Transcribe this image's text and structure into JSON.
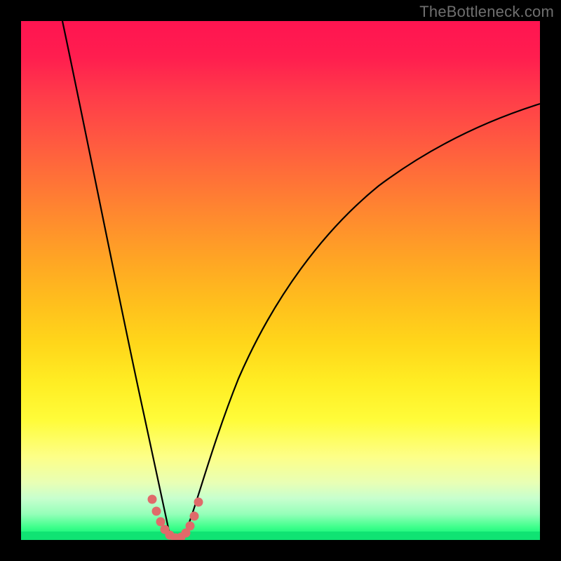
{
  "watermark": "TheBottleneck.com",
  "chart_data": {
    "type": "line",
    "title": "",
    "xlabel": "",
    "ylabel": "",
    "xlim": [
      0,
      100
    ],
    "ylim": [
      0,
      100
    ],
    "background_gradient": {
      "top": "#ff1450",
      "bottom": "#10e373",
      "meaning": "red=high bottleneck, green=low bottleneck"
    },
    "series": [
      {
        "name": "left-arm",
        "x": [
          8,
          10,
          12,
          14,
          16,
          18,
          20,
          22,
          24,
          25,
          26,
          27,
          28
        ],
        "values": [
          100,
          85,
          71,
          58,
          47,
          36,
          27,
          18,
          10,
          6,
          3,
          1.2,
          0.3
        ]
      },
      {
        "name": "right-arm",
        "x": [
          32,
          33,
          34,
          36,
          38,
          41,
          45,
          50,
          56,
          63,
          71,
          80,
          90,
          100
        ],
        "values": [
          0.3,
          1.5,
          3.5,
          8,
          13,
          20,
          28,
          36,
          44,
          52,
          60,
          67,
          73,
          79
        ]
      },
      {
        "name": "valley-markers",
        "x": [
          25.5,
          26.3,
          27.0,
          27.8,
          28.6,
          29.4,
          30.2,
          31.0,
          31.8,
          32.6,
          33.4
        ],
        "values": [
          7.2,
          4.3,
          2.4,
          1.1,
          0.4,
          0.2,
          0.3,
          0.9,
          2.1,
          4.2,
          7.3
        ]
      }
    ],
    "valley_center_x": 30
  }
}
